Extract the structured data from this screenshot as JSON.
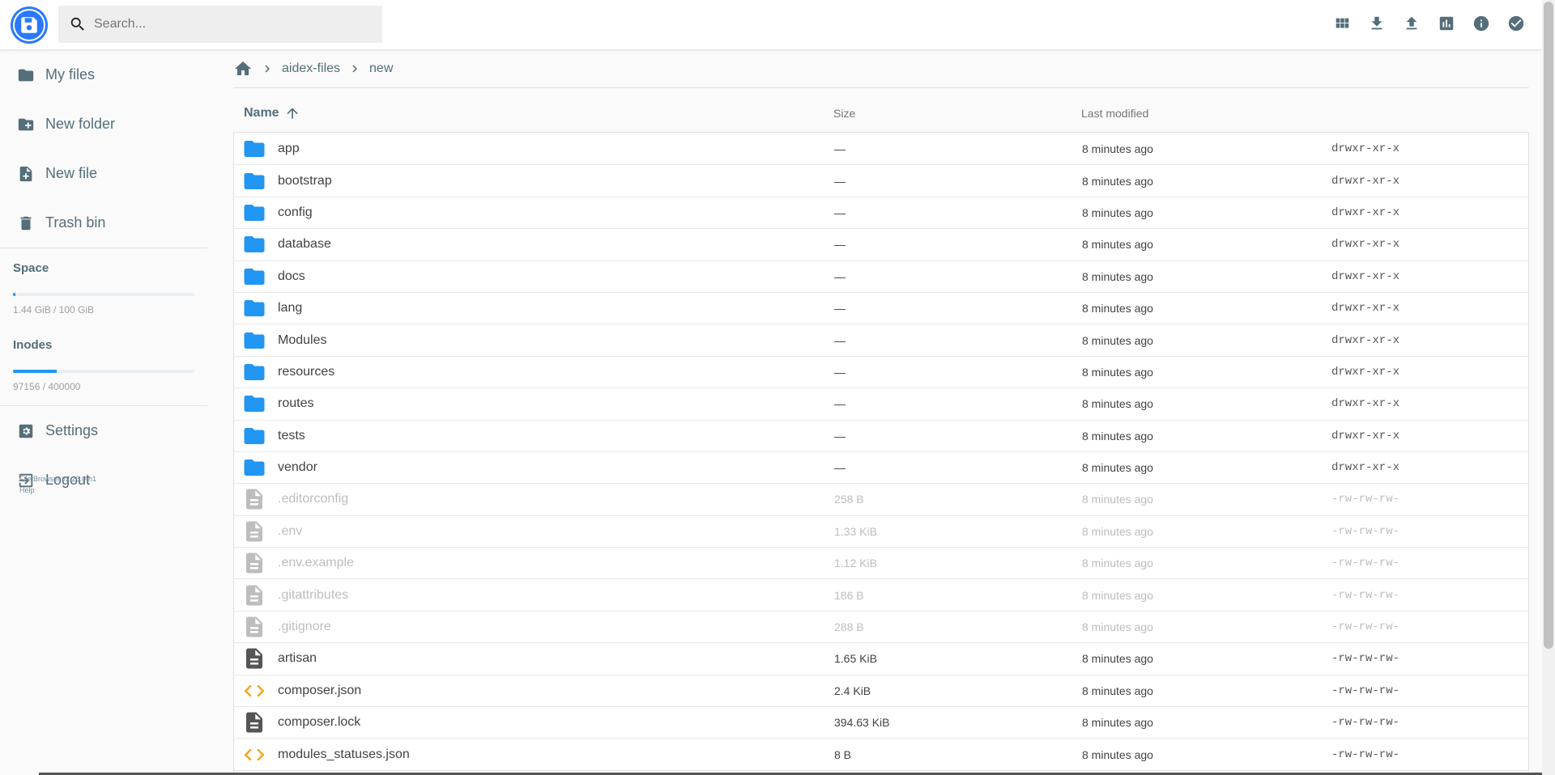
{
  "header": {
    "search_placeholder": "Search...",
    "actions": [
      {
        "icon": "view-grid-icon"
      },
      {
        "icon": "download-icon"
      },
      {
        "icon": "upload-icon"
      },
      {
        "icon": "chart-icon"
      },
      {
        "icon": "info-icon"
      },
      {
        "icon": "check-circle-icon"
      }
    ]
  },
  "sidebar": {
    "items": [
      {
        "label": "My files",
        "icon": "folder-icon"
      },
      {
        "label": "New folder",
        "icon": "create-new-folder-icon"
      },
      {
        "label": "New file",
        "icon": "note-add-icon"
      },
      {
        "label": "Trash bin",
        "icon": "trash-icon"
      }
    ],
    "space": {
      "title": "Space",
      "value": "1.44 GiB / 100 GiB",
      "fraction": 0.0144
    },
    "inodes": {
      "title": "Inodes",
      "value": "97156 / 400000",
      "fraction": 0.2429
    },
    "bottom_items": [
      {
        "label": "Settings",
        "icon": "settings-icon"
      },
      {
        "label": "Logout",
        "icon": "logout-icon"
      }
    ],
    "credits": {
      "version": "File Browser v2.26.0-h1",
      "help": "Help"
    }
  },
  "breadcrumbs": {
    "items": [
      "aidex-files",
      "new"
    ]
  },
  "listing": {
    "columns": {
      "name": "Name",
      "size": "Size",
      "modified": "Last modified"
    },
    "rows": [
      {
        "name": "app",
        "size": "—",
        "modified": "8 minutes ago",
        "perm": "drwxr-xr-x",
        "type": "folder",
        "dim": false
      },
      {
        "name": "bootstrap",
        "size": "—",
        "modified": "8 minutes ago",
        "perm": "drwxr-xr-x",
        "type": "folder",
        "dim": false
      },
      {
        "name": "config",
        "size": "—",
        "modified": "8 minutes ago",
        "perm": "drwxr-xr-x",
        "type": "folder",
        "dim": false
      },
      {
        "name": "database",
        "size": "—",
        "modified": "8 minutes ago",
        "perm": "drwxr-xr-x",
        "type": "folder",
        "dim": false
      },
      {
        "name": "docs",
        "size": "—",
        "modified": "8 minutes ago",
        "perm": "drwxr-xr-x",
        "type": "folder",
        "dim": false
      },
      {
        "name": "lang",
        "size": "—",
        "modified": "8 minutes ago",
        "perm": "drwxr-xr-x",
        "type": "folder",
        "dim": false
      },
      {
        "name": "Modules",
        "size": "—",
        "modified": "8 minutes ago",
        "perm": "drwxr-xr-x",
        "type": "folder",
        "dim": false
      },
      {
        "name": "resources",
        "size": "—",
        "modified": "8 minutes ago",
        "perm": "drwxr-xr-x",
        "type": "folder",
        "dim": false
      },
      {
        "name": "routes",
        "size": "—",
        "modified": "8 minutes ago",
        "perm": "drwxr-xr-x",
        "type": "folder",
        "dim": false
      },
      {
        "name": "tests",
        "size": "—",
        "modified": "8 minutes ago",
        "perm": "drwxr-xr-x",
        "type": "folder",
        "dim": false
      },
      {
        "name": "vendor",
        "size": "—",
        "modified": "8 minutes ago",
        "perm": "drwxr-xr-x",
        "type": "folder",
        "dim": false
      },
      {
        "name": ".editorconfig",
        "size": "258 B",
        "modified": "8 minutes ago",
        "perm": "-rw-rw-rw-",
        "type": "file",
        "dim": true
      },
      {
        "name": ".env",
        "size": "1.33 KiB",
        "modified": "8 minutes ago",
        "perm": "-rw-rw-rw-",
        "type": "file",
        "dim": true
      },
      {
        "name": ".env.example",
        "size": "1.12 KiB",
        "modified": "8 minutes ago",
        "perm": "-rw-rw-rw-",
        "type": "file",
        "dim": true
      },
      {
        "name": ".gitattributes",
        "size": "186 B",
        "modified": "8 minutes ago",
        "perm": "-rw-rw-rw-",
        "type": "file",
        "dim": true
      },
      {
        "name": ".gitignore",
        "size": "288 B",
        "modified": "8 minutes ago",
        "perm": "-rw-rw-rw-",
        "type": "file",
        "dim": true
      },
      {
        "name": "artisan",
        "size": "1.65 KiB",
        "modified": "8 minutes ago",
        "perm": "-rw-rw-rw-",
        "type": "file",
        "dim": false
      },
      {
        "name": "composer.json",
        "size": "2.4 KiB",
        "modified": "8 minutes ago",
        "perm": "-rw-rw-rw-",
        "type": "code",
        "dim": false
      },
      {
        "name": "composer.lock",
        "size": "394.63 KiB",
        "modified": "8 minutes ago",
        "perm": "-rw-rw-rw-",
        "type": "file",
        "dim": false
      },
      {
        "name": "modules_statuses.json",
        "size": "8 B",
        "modified": "8 minutes ago",
        "perm": "-rw-rw-rw-",
        "type": "code",
        "dim": false
      }
    ]
  },
  "colors": {
    "accent": "#2196f3",
    "folder": "#2196f3",
    "code": "#f5a623",
    "text_muted": "#546e7a"
  }
}
